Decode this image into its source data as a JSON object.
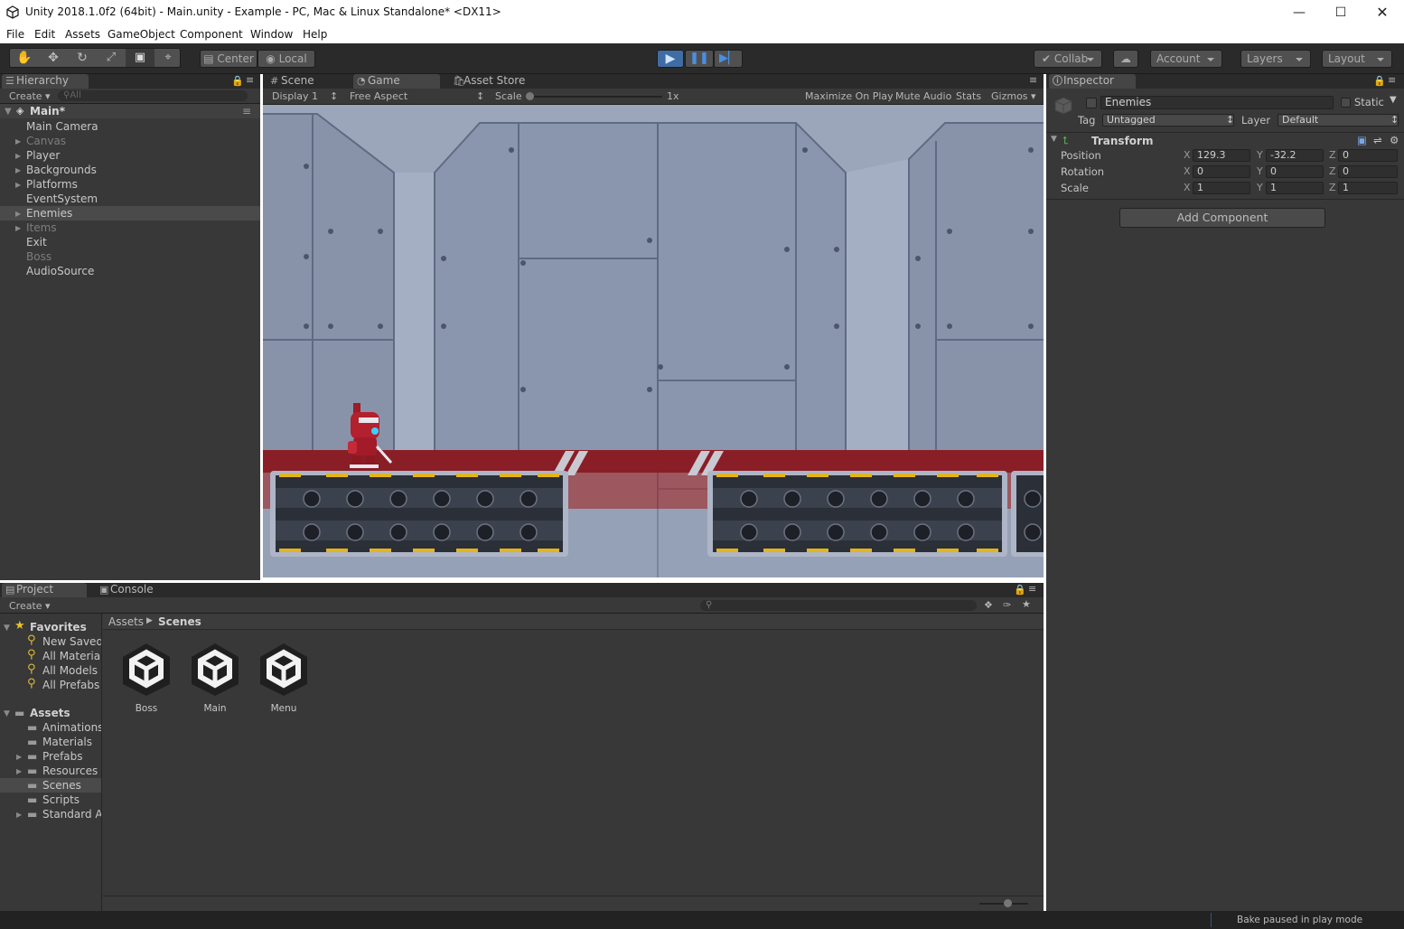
{
  "window": {
    "title": "Unity 2018.1.0f2 (64bit) - Main.unity - Example - PC, Mac & Linux Standalone* <DX11>"
  },
  "menu": [
    "File",
    "Edit",
    "Assets",
    "GameObject",
    "Component",
    "Window",
    "Help"
  ],
  "toolbar": {
    "pivot": "Center",
    "space": "Local",
    "collab": "Collab",
    "account": "Account",
    "layers": "Layers",
    "layout": "Layout",
    "play_state": "playing"
  },
  "hierarchy": {
    "tab": "Hierarchy",
    "create": "Create",
    "search_placeholder": "All",
    "scene": "Main*",
    "items": [
      {
        "label": "Main Camera",
        "expandable": false,
        "dim": false
      },
      {
        "label": "Canvas",
        "expandable": true,
        "dim": true
      },
      {
        "label": "Player",
        "expandable": true,
        "dim": false
      },
      {
        "label": "Backgrounds",
        "expandable": true,
        "dim": false
      },
      {
        "label": "Platforms",
        "expandable": true,
        "dim": false
      },
      {
        "label": "EventSystem",
        "expandable": false,
        "dim": false
      },
      {
        "label": "Enemies",
        "expandable": true,
        "dim": false,
        "selected": true
      },
      {
        "label": "Items",
        "expandable": true,
        "dim": true
      },
      {
        "label": "Exit",
        "expandable": false,
        "dim": false
      },
      {
        "label": "Boss",
        "expandable": false,
        "dim": true
      },
      {
        "label": "AudioSource",
        "expandable": false,
        "dim": false
      }
    ]
  },
  "center_tabs": {
    "scene": "Scene",
    "game": "Game",
    "store": "Asset Store"
  },
  "game_bar": {
    "display": "Display 1",
    "aspect": "Free Aspect",
    "scale_label": "Scale",
    "scale_value": "1x",
    "maximize": "Maximize On Play",
    "mute": "Mute Audio",
    "stats": "Stats",
    "gizmos": "Gizmos"
  },
  "inspector": {
    "tab": "Inspector",
    "name": "Enemies",
    "static_label": "Static",
    "tag_label": "Tag",
    "tag": "Untagged",
    "layer_label": "Layer",
    "layer": "Default",
    "component": "Transform",
    "rows": [
      {
        "label": "Position",
        "x": "129.3",
        "y": "-32.2",
        "z": "0"
      },
      {
        "label": "Rotation",
        "x": "0",
        "y": "0",
        "z": "0"
      },
      {
        "label": "Scale",
        "x": "1",
        "y": "1",
        "z": "1"
      }
    ],
    "axis": {
      "x": "X",
      "y": "Y",
      "z": "Z"
    },
    "add_component": "Add Component"
  },
  "project": {
    "tab_project": "Project",
    "tab_console": "Console",
    "create": "Create",
    "favorites_label": "Favorites",
    "favorites": [
      "New Saved",
      "All Materials",
      "All Models",
      "All Prefabs"
    ],
    "assets_label": "Assets",
    "folders": [
      {
        "label": "Animations",
        "expandable": false
      },
      {
        "label": "Materials",
        "expandable": false
      },
      {
        "label": "Prefabs",
        "expandable": true
      },
      {
        "label": "Resources",
        "expandable": true
      },
      {
        "label": "Scenes",
        "expandable": false,
        "selected": true
      },
      {
        "label": "Scripts",
        "expandable": false
      },
      {
        "label": "Standard Assets",
        "expandable": true
      }
    ],
    "breadcrumb": [
      "Assets",
      "Scenes"
    ],
    "files": [
      "Boss",
      "Main",
      "Menu"
    ]
  },
  "status": "Bake paused in play mode",
  "colors": {
    "accent": "#3a72b0",
    "selected_row": "#4a4a4a",
    "panel": "#383838"
  }
}
